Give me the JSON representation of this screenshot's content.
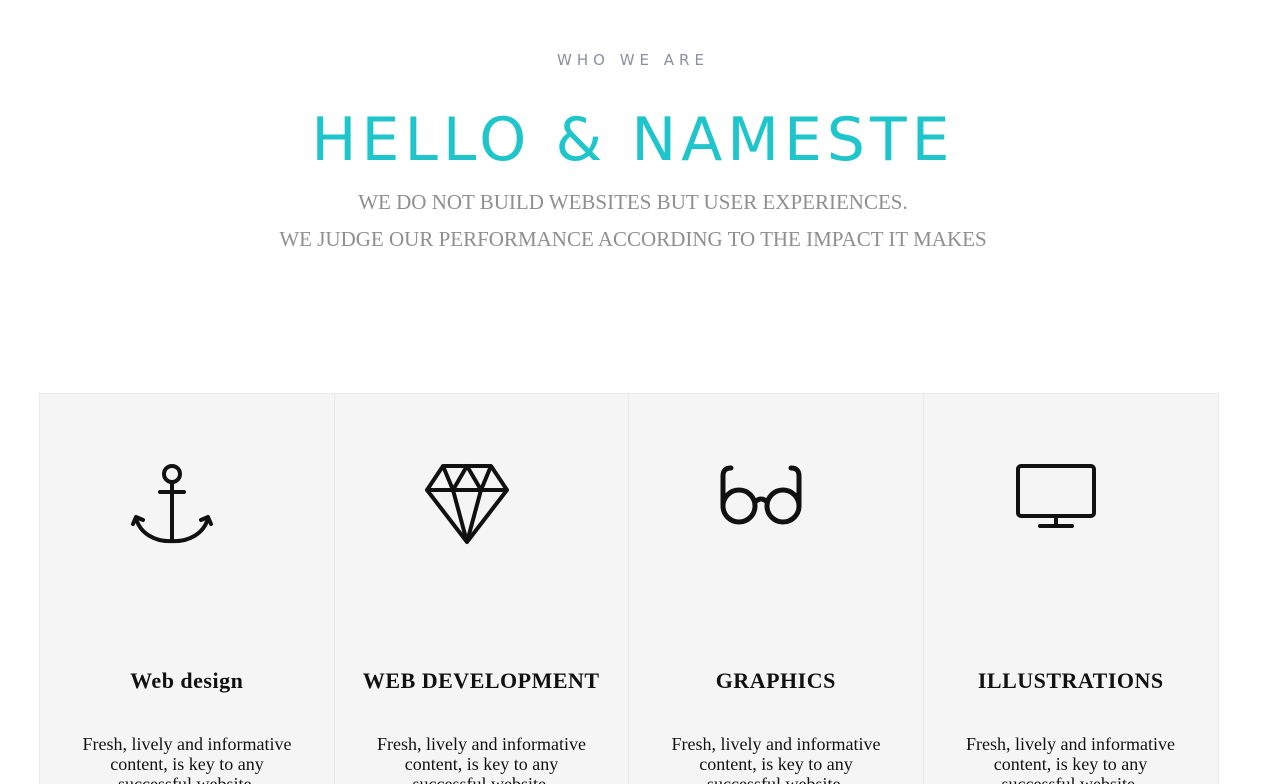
{
  "intro": {
    "eyebrow": "WHO WE ARE",
    "headline": "HELLO & NAMESTE",
    "tagline_line1": "WE DO NOT BUILD WEBSITES BUT USER EXPERIENCES.",
    "tagline_line2": "WE JUDGE OUR PERFORMANCE ACCORDING TO THE IMPACT IT MAKES"
  },
  "colors": {
    "accent": "#1ec6cc",
    "muted_text": "#8f8f8f",
    "panel_background": "#f5f5f5"
  },
  "features": [
    {
      "icon": "anchor-icon",
      "title": "Web design",
      "description": "Fresh, lively and informative content, is key to any successful website."
    },
    {
      "icon": "diamond-icon",
      "title": "WEB DEVELOPMENT",
      "description": "Fresh, lively and informative content, is key to any successful website."
    },
    {
      "icon": "glasses-icon",
      "title": "GRAPHICS",
      "description": "Fresh, lively and informative content, is key to any successful website."
    },
    {
      "icon": "monitor-icon",
      "title": "ILLUSTRATIONS",
      "description": "Fresh, lively and informative content, is key to any successful website."
    }
  ]
}
